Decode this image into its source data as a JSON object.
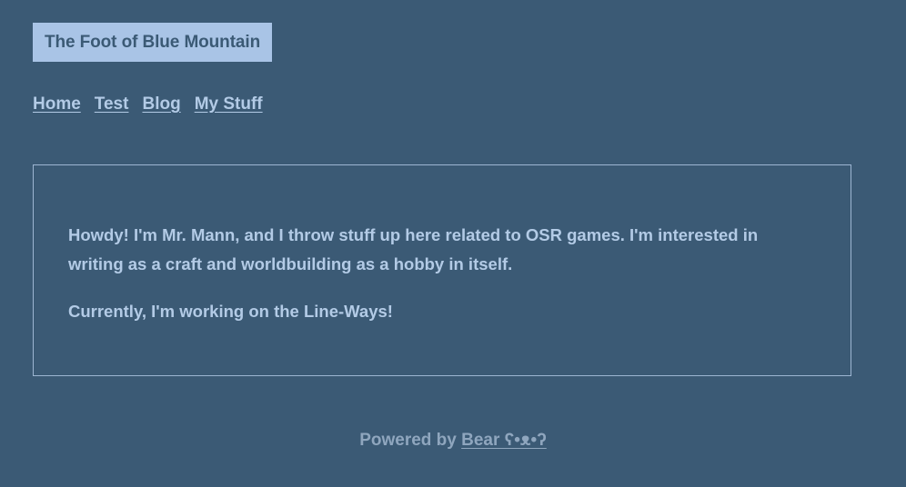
{
  "header": {
    "site_title": "The Foot of Blue Mountain"
  },
  "nav": {
    "items": [
      {
        "label": "Home"
      },
      {
        "label": "Test"
      },
      {
        "label": "Blog"
      },
      {
        "label": "My Stuff"
      }
    ]
  },
  "main": {
    "paragraph_1": "Howdy! I'm Mr. Mann, and I throw stuff up here related to OSR games. I'm interested in writing as a craft and worldbuilding as a hobby in itself.",
    "paragraph_2": "Currently, I'm working on the Line-Ways!"
  },
  "footer": {
    "prefix": "Powered by ",
    "link_label": "Bear ʕ•ᴥ•ʔ"
  },
  "colors": {
    "background": "#3b5a75",
    "title_badge": "#a9c4e6",
    "text": "#b3cbe6",
    "footer_text": "#8fa6be"
  }
}
